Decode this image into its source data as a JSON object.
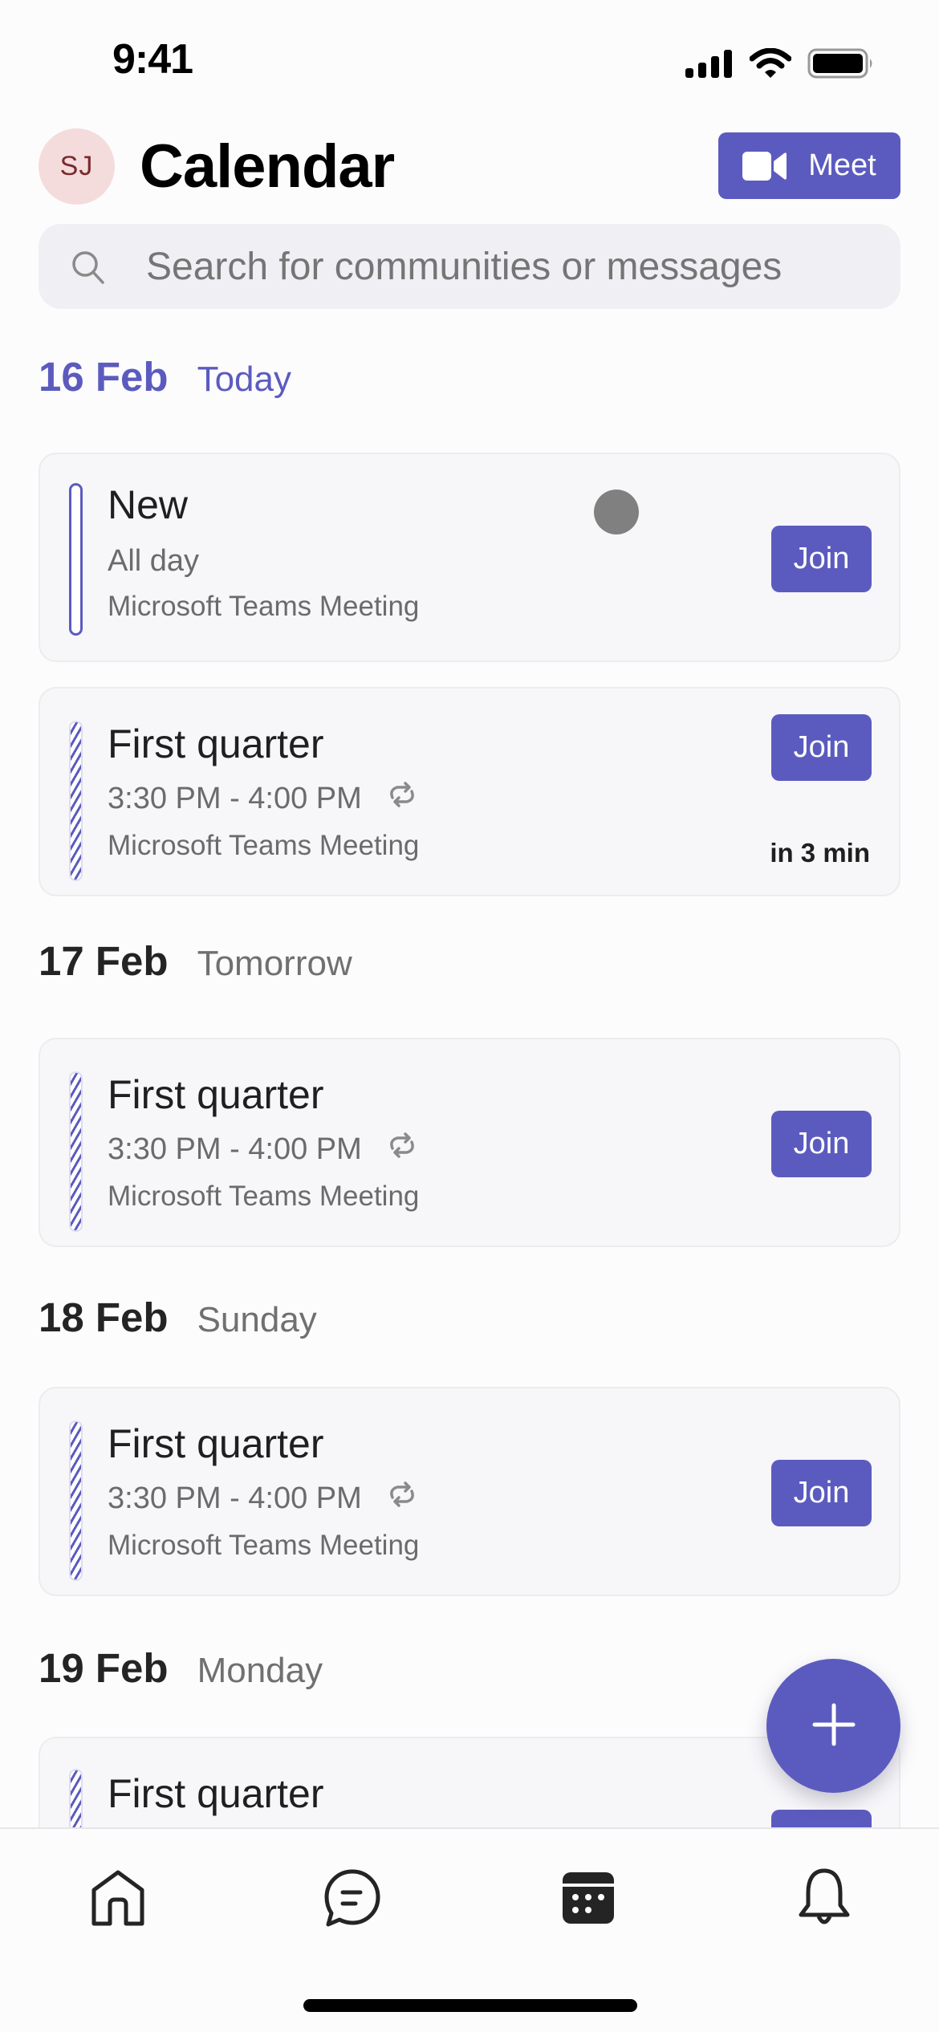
{
  "status_bar": {
    "time": "9:41"
  },
  "header": {
    "avatar_initials": "SJ",
    "title": "Calendar",
    "meet_label": "Meet"
  },
  "search": {
    "placeholder": "Search for communities or messages",
    "value": ""
  },
  "colors": {
    "accent": "#5b5bbf",
    "avatar_bg": "#f5dcdc",
    "avatar_text": "#7a2a2e"
  },
  "days": [
    {
      "date": "16 Feb",
      "relative": "Today",
      "is_today": true,
      "events": [
        {
          "title": "New",
          "time": "All day",
          "recurring": false,
          "location": "Microsoft Teams Meeting",
          "join_label": "Join",
          "bar_style": "solid",
          "countdown": ""
        }
      ]
    },
    {
      "date": "16 Feb",
      "relative": "Today",
      "is_today": true,
      "events": [
        {
          "title": "First quarter",
          "time": "3:30 PM - 4:00 PM",
          "recurring": true,
          "location": "Microsoft Teams Meeting",
          "join_label": "Join",
          "bar_style": "striped",
          "countdown": "in 3 min"
        }
      ]
    },
    {
      "date": "17 Feb",
      "relative": "Tomorrow",
      "is_today": false,
      "events": [
        {
          "title": "First quarter",
          "time": "3:30 PM - 4:00 PM",
          "recurring": true,
          "location": "Microsoft Teams Meeting",
          "join_label": "Join",
          "bar_style": "striped"
        }
      ]
    },
    {
      "date": "18 Feb",
      "relative": "Sunday",
      "is_today": false,
      "events": [
        {
          "title": "First quarter",
          "time": "3:30 PM - 4:00 PM",
          "recurring": true,
          "location": "Microsoft Teams Meeting",
          "join_label": "Join",
          "bar_style": "striped"
        }
      ]
    },
    {
      "date": "19 Feb",
      "relative": "Monday",
      "is_today": false,
      "events": [
        {
          "title": "First quarter",
          "bar_style": "striped"
        }
      ]
    }
  ],
  "fab": {
    "icon": "plus-icon"
  },
  "bottom_nav": {
    "items": [
      {
        "name": "home",
        "icon": "home-icon",
        "active": false
      },
      {
        "name": "chat",
        "icon": "chat-icon",
        "active": false
      },
      {
        "name": "calendar",
        "icon": "calendar-icon",
        "active": true
      },
      {
        "name": "activity",
        "icon": "bell-icon",
        "active": false
      }
    ]
  }
}
